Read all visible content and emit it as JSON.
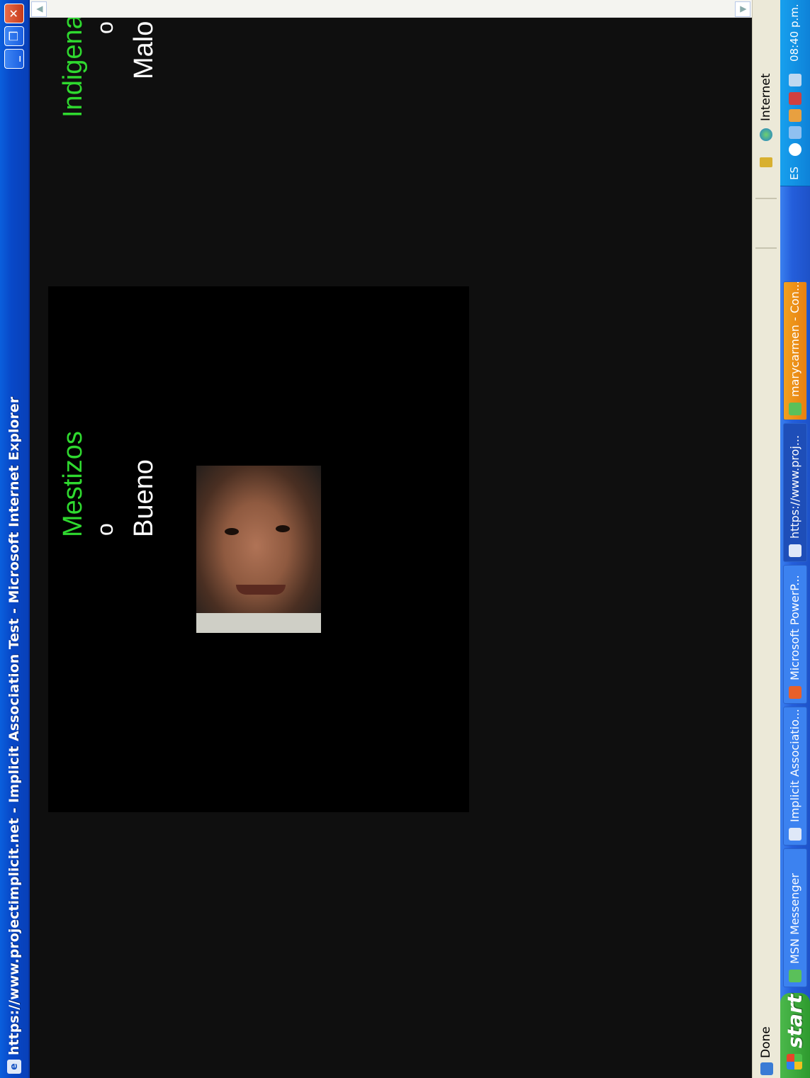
{
  "window": {
    "title": "https://www.projectimplicit.net - Implicit Association Test - Microsoft Internet Explorer",
    "minimize_icon": "_",
    "maximize_icon": "❐",
    "close_icon": "✕"
  },
  "test": {
    "left_category": "Mestizos",
    "left_connector": "o",
    "left_attribute": "Bueno",
    "right_category": "Indigenas",
    "right_connector": "o",
    "right_attribute": "Malo",
    "category_color": "#2fd92f",
    "attribute_color": "#ffffff",
    "stimulus": "face-photo"
  },
  "statusbar": {
    "status": "Done",
    "zone": "Internet"
  },
  "taskbar": {
    "start_label": "start",
    "tasks": [
      {
        "label": "MSN Messenger",
        "icon": "msn-icon"
      },
      {
        "label": "Implicit Associatio...",
        "icon": "ie-icon"
      },
      {
        "label": "Microsoft PowerP...",
        "icon": "powerpoint-icon"
      },
      {
        "label": "https://www.proj...",
        "icon": "ie-icon"
      },
      {
        "label": "marycarmen - Con...",
        "icon": "msn-chat-icon"
      }
    ],
    "tray": {
      "language": "ES",
      "clock": "08:40 p.m."
    }
  }
}
